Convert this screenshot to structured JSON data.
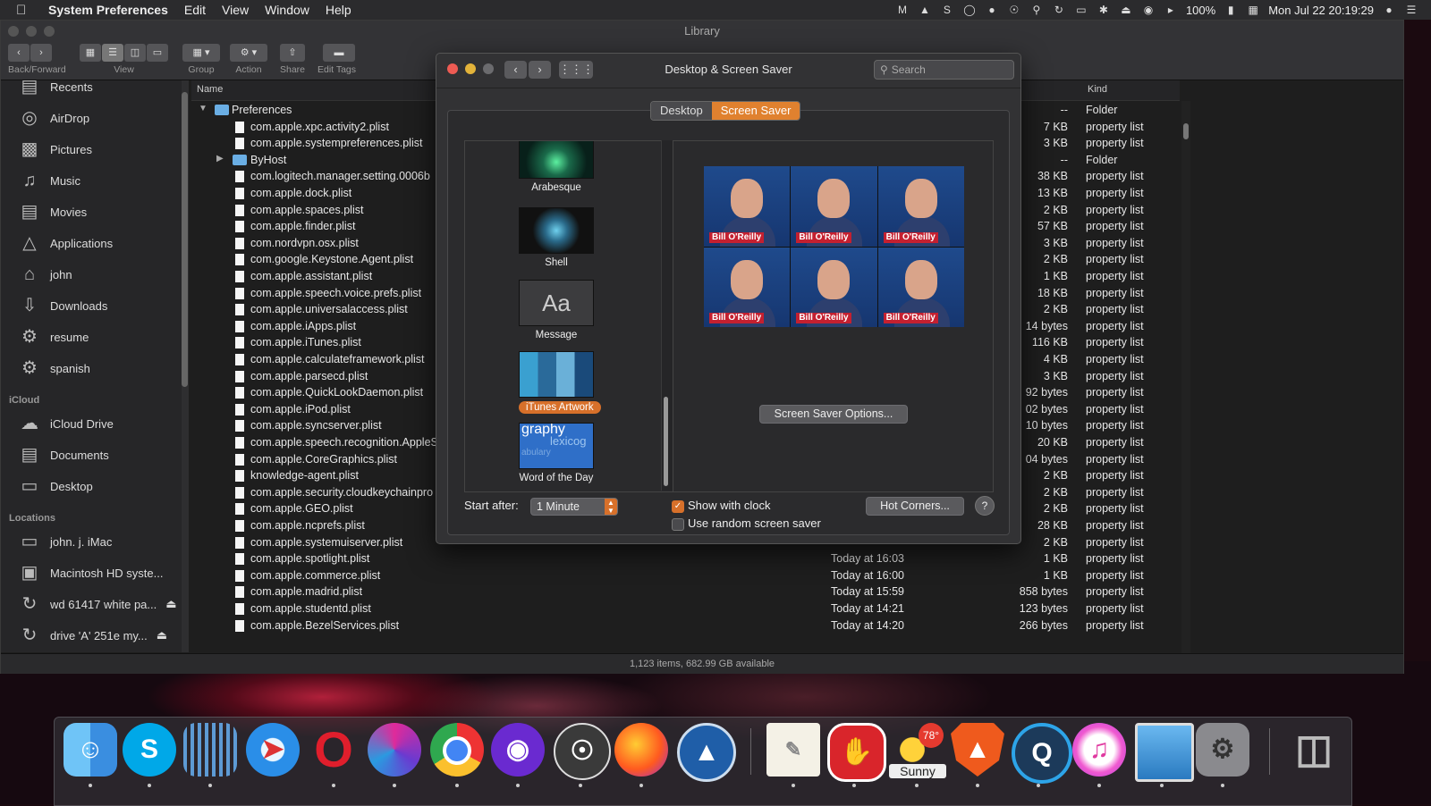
{
  "menubar": {
    "app": "System Preferences",
    "items": [
      "Edit",
      "View",
      "Window",
      "Help"
    ],
    "battery": "100%",
    "clock": "Mon Jul 22  20:19:29"
  },
  "finder": {
    "title": "Library",
    "toolbar": {
      "back_forward": "Back/Forward",
      "view": "View",
      "group": "Group",
      "action": "Action",
      "share": "Share",
      "edit_tags": "Edit Tags"
    },
    "sidebar": {
      "favorites": [
        "Recents",
        "AirDrop",
        "Pictures",
        "Music",
        "Movies",
        "Applications",
        "john",
        "Downloads",
        "resume",
        "spanish"
      ],
      "icloud_header": "iCloud",
      "icloud": [
        "iCloud Drive",
        "Documents",
        "Desktop"
      ],
      "locations_header": "Locations",
      "locations": [
        "john. j. iMac",
        "Macintosh HD  syste...",
        "wd 61417 white pa...",
        "drive 'A' 251e  my..."
      ]
    },
    "columns": {
      "name": "Name",
      "kind": "Kind"
    },
    "rows": [
      {
        "name": "Preferences",
        "date": "",
        "size": "--",
        "kind": "Folder"
      },
      {
        "name": "com.apple.xpc.activity2.plist",
        "date": "",
        "size": "7 KB",
        "kind": "property list"
      },
      {
        "name": "com.apple.systempreferences.plist",
        "date": "",
        "size": "3 KB",
        "kind": "property list"
      },
      {
        "name": "ByHost",
        "date": "",
        "size": "--",
        "kind": "Folder"
      },
      {
        "name": "com.logitech.manager.setting.0006b",
        "date": "",
        "size": "38 KB",
        "kind": "property list"
      },
      {
        "name": "com.apple.dock.plist",
        "date": "",
        "size": "13 KB",
        "kind": "property list"
      },
      {
        "name": "com.apple.spaces.plist",
        "date": "",
        "size": "2 KB",
        "kind": "property list"
      },
      {
        "name": "com.apple.finder.plist",
        "date": "",
        "size": "57 KB",
        "kind": "property list"
      },
      {
        "name": "com.nordvpn.osx.plist",
        "date": "",
        "size": "3 KB",
        "kind": "property list"
      },
      {
        "name": "com.google.Keystone.Agent.plist",
        "date": "",
        "size": "2 KB",
        "kind": "property list"
      },
      {
        "name": "com.apple.assistant.plist",
        "date": "",
        "size": "1 KB",
        "kind": "property list"
      },
      {
        "name": "com.apple.speech.voice.prefs.plist",
        "date": "",
        "size": "18 KB",
        "kind": "property list"
      },
      {
        "name": "com.apple.universalaccess.plist",
        "date": "",
        "size": "2 KB",
        "kind": "property list"
      },
      {
        "name": "com.apple.iApps.plist",
        "date": "",
        "size": "14 bytes",
        "kind": "property list"
      },
      {
        "name": "com.apple.iTunes.plist",
        "date": "",
        "size": "116 KB",
        "kind": "property list"
      },
      {
        "name": "com.apple.calculateframework.plist",
        "date": "",
        "size": "4 KB",
        "kind": "property list"
      },
      {
        "name": "com.apple.parsecd.plist",
        "date": "",
        "size": "3 KB",
        "kind": "property list"
      },
      {
        "name": "com.apple.QuickLookDaemon.plist",
        "date": "",
        "size": "92 bytes",
        "kind": "property list"
      },
      {
        "name": "com.apple.iPod.plist",
        "date": "",
        "size": "02 bytes",
        "kind": "property list"
      },
      {
        "name": "com.apple.syncserver.plist",
        "date": "",
        "size": "10 bytes",
        "kind": "property list"
      },
      {
        "name": "com.apple.speech.recognition.AppleS",
        "date": "",
        "size": "20 KB",
        "kind": "property list"
      },
      {
        "name": "com.apple.CoreGraphics.plist",
        "date": "",
        "size": "04 bytes",
        "kind": "property list"
      },
      {
        "name": "knowledge-agent.plist",
        "date": "",
        "size": "2 KB",
        "kind": "property list"
      },
      {
        "name": "com.apple.security.cloudkeychainpro",
        "date": "",
        "size": "2 KB",
        "kind": "property list"
      },
      {
        "name": "com.apple.GEO.plist",
        "date": "",
        "size": "2 KB",
        "kind": "property list"
      },
      {
        "name": "com.apple.ncprefs.plist",
        "date": "",
        "size": "28 KB",
        "kind": "property list"
      },
      {
        "name": "com.apple.systemuiserver.plist",
        "date": "",
        "size": "2 KB",
        "kind": "property list"
      },
      {
        "name": "com.apple.spotlight.plist",
        "date": "Today at 16:03",
        "size": "1 KB",
        "kind": "property list"
      },
      {
        "name": "com.apple.commerce.plist",
        "date": "Today at 16:00",
        "size": "1 KB",
        "kind": "property list"
      },
      {
        "name": "com.apple.madrid.plist",
        "date": "Today at 15:59",
        "size": "858 bytes",
        "kind": "property list"
      },
      {
        "name": "com.apple.studentd.plist",
        "date": "Today at 14:21",
        "size": "123 bytes",
        "kind": "property list"
      },
      {
        "name": "com.apple.BezelServices.plist",
        "date": "Today at 14:20",
        "size": "266 bytes",
        "kind": "property list"
      }
    ],
    "status": "1,123 items, 682.99 GB available"
  },
  "dialog": {
    "title": "Desktop & Screen Saver",
    "search_placeholder": "Search",
    "tabs": [
      "Desktop",
      "Screen Saver"
    ],
    "savers": [
      "Arabesque",
      "Shell",
      "Message",
      "iTunes Artwork",
      "Word of the Day"
    ],
    "message_thumb": "Aa",
    "word_thumb_top": "graphy",
    "word_thumb_mid": "lexicog",
    "word_thumb_bot": "abulary",
    "preview_tag": "Bill O'Reilly",
    "options_button": "Screen Saver Options...",
    "start_after_label": "Start after:",
    "start_after_value": "1 Minute",
    "show_clock": "Show with clock",
    "random_saver": "Use random screen saver",
    "hot_corners": "Hot Corners...",
    "help": "?"
  },
  "dock": {
    "weather_temp": "78°",
    "weather_label": "Sunny"
  }
}
